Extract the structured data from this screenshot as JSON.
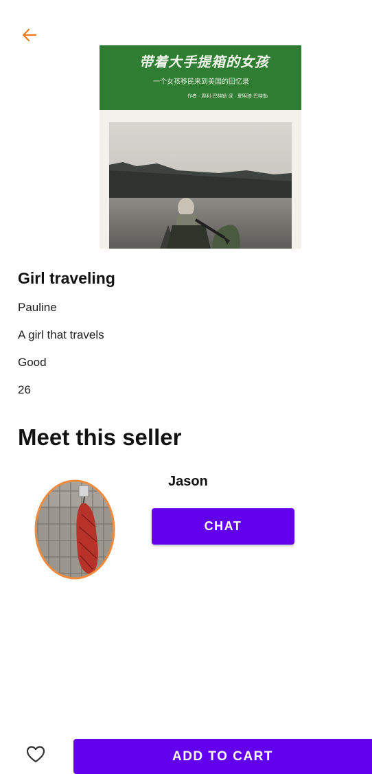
{
  "header": {
    "back_icon": "arrow-left-icon",
    "accent_color": "#f07a1a"
  },
  "book": {
    "cover": {
      "title_text": "带着大手提箱的女孩",
      "subtitle_text": "一个女孩移民来到美国的回忆录",
      "author_text": "作者 · 周利·巴特勒 译 · 夏明琦·巴特勒",
      "band_color": "#2f7d33"
    },
    "title": "Girl traveling",
    "author": "Pauline",
    "description": "A girl that travels",
    "condition": "Good",
    "price": "26"
  },
  "seller_section": {
    "heading": "Meet this seller",
    "name": "Jason",
    "chat_label": "CHAT",
    "avatar_border_color": "#f08a3c"
  },
  "bottom_bar": {
    "favorite_icon": "heart-outline-icon",
    "add_to_cart_label": "ADD TO CART",
    "primary_color": "#6200ee"
  }
}
